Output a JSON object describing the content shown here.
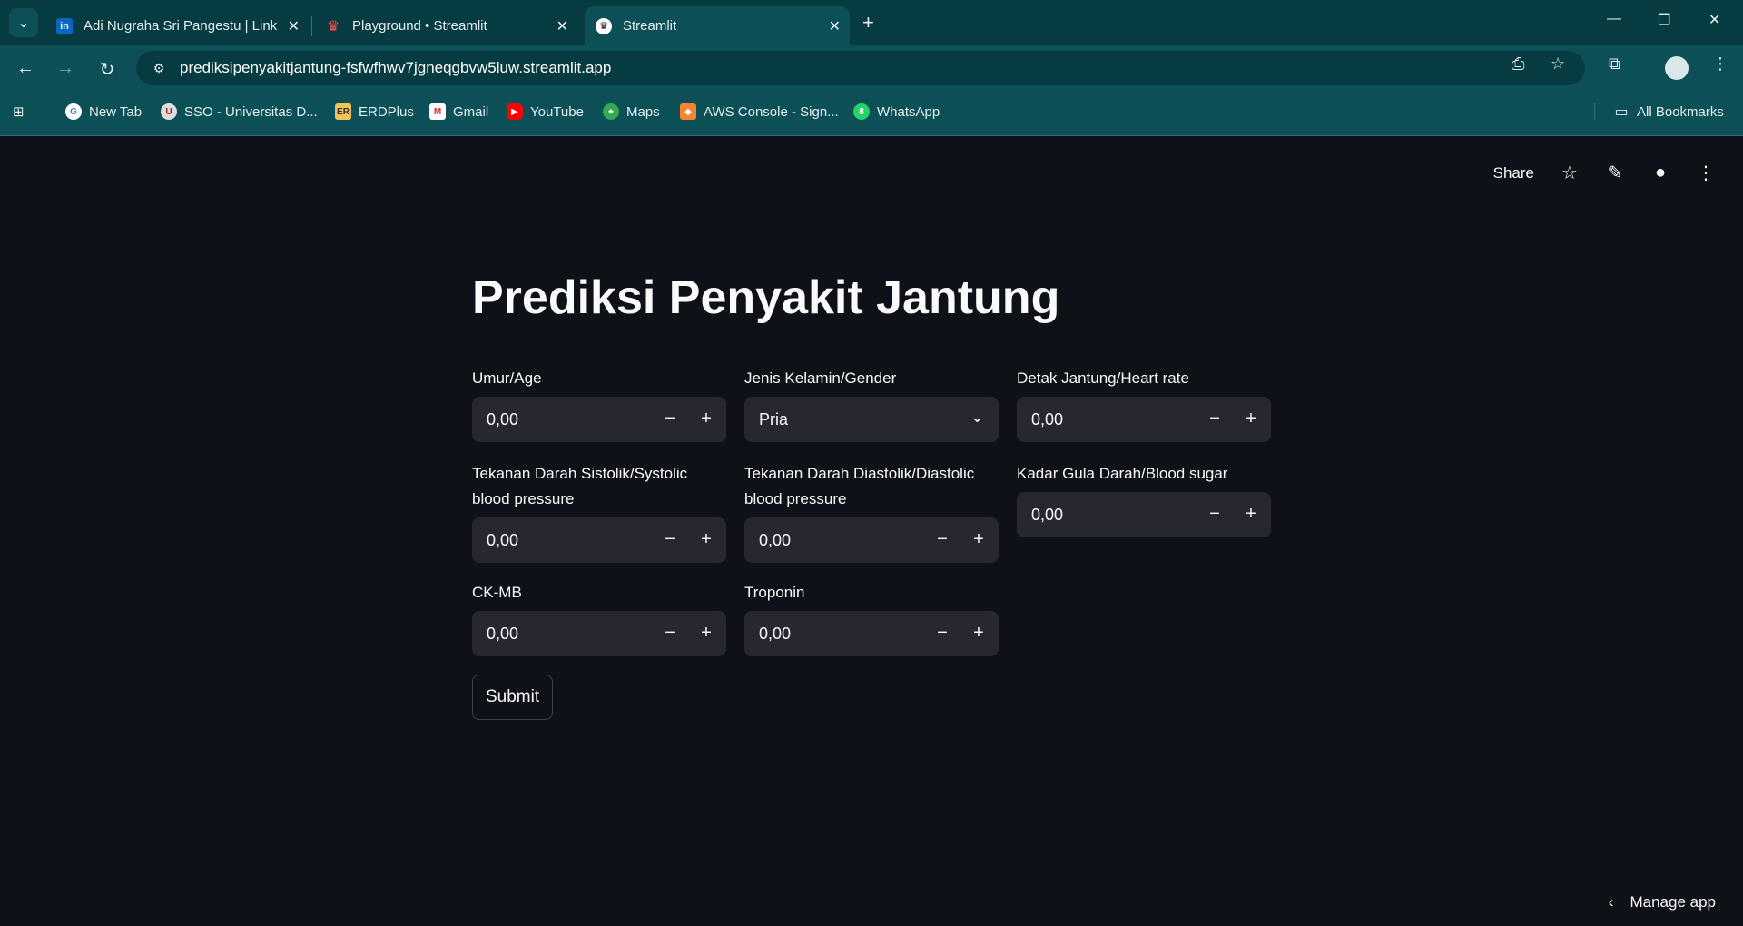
{
  "browser": {
    "tabs": [
      {
        "title": "Adi Nugraha Sri Pangestu | Link",
        "favicon": "linkedin-icon",
        "active": false
      },
      {
        "title": "Playground • Streamlit",
        "favicon": "streamlit-icon",
        "active": false
      },
      {
        "title": "Streamlit",
        "favicon": "streamlit-icon",
        "active": true
      }
    ],
    "url": "prediksipenyakitjantung-fsfwfhwv7jgneqgbvw5luw.streamlit.app",
    "bookmarks": [
      {
        "label": "New Tab",
        "icon": "google-icon"
      },
      {
        "label": "SSO - Universitas D...",
        "icon": "sso-icon"
      },
      {
        "label": "ERDPlus",
        "icon": "erdplus-icon"
      },
      {
        "label": "Gmail",
        "icon": "gmail-icon"
      },
      {
        "label": "YouTube",
        "icon": "youtube-icon"
      },
      {
        "label": "Maps",
        "icon": "maps-icon"
      },
      {
        "label": "AWS Console - Sign...",
        "icon": "aws-icon"
      },
      {
        "label": "WhatsApp",
        "icon": "whatsapp-icon"
      }
    ],
    "all_bookmarks": "All Bookmarks"
  },
  "app": {
    "header": {
      "share": "Share"
    },
    "title": "Prediksi Penyakit Jantung",
    "fields": {
      "age": {
        "label": "Umur/Age",
        "value": "0,00"
      },
      "gender": {
        "label": "Jenis Kelamin/Gender",
        "value": "Pria"
      },
      "heart_rate": {
        "label": "Detak Jantung/Heart rate",
        "value": "0,00"
      },
      "systolic": {
        "label": "Tekanan Darah Sistolik/Systolic blood pressure",
        "value": "0,00"
      },
      "diastolic": {
        "label": "Tekanan Darah Diastolik/Diastolic blood pressure",
        "value": "0,00"
      },
      "blood_sugar": {
        "label": "Kadar Gula Darah/Blood sugar",
        "value": "0,00"
      },
      "ckmb": {
        "label": "CK-MB",
        "value": "0,00"
      },
      "troponin": {
        "label": "Troponin",
        "value": "0,00"
      }
    },
    "submit": "Submit",
    "manage_app": "Manage app"
  },
  "colors": {
    "background": "#0e1117",
    "input_bg": "#262730",
    "chrome_toolbar": "#0d4f57",
    "chrome_tabstrip": "#063b42"
  }
}
